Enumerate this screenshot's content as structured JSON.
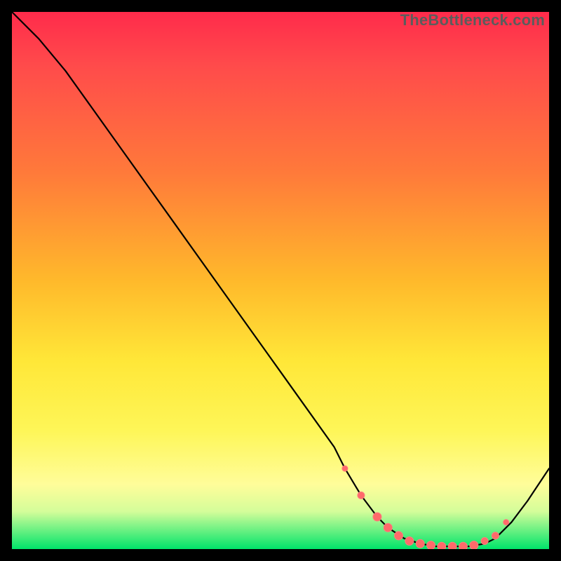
{
  "watermark": "TheBottleneck.com",
  "colors": {
    "curve": "#000000",
    "dot": "#ff6a6a",
    "gradient_top": "#ff2b4b",
    "gradient_bottom": "#00e46a"
  },
  "chart_data": {
    "type": "line",
    "title": "",
    "xlabel": "",
    "ylabel": "",
    "xlim": [
      0,
      100
    ],
    "ylim": [
      0,
      100
    ],
    "series": [
      {
        "name": "curve",
        "x": [
          0,
          5,
          10,
          15,
          20,
          25,
          30,
          35,
          40,
          45,
          50,
          55,
          60,
          62,
          65,
          68,
          70,
          73,
          76,
          79,
          82,
          85,
          88,
          90,
          93,
          96,
          100
        ],
        "y": [
          100,
          95,
          89,
          82,
          75,
          68,
          61,
          54,
          47,
          40,
          33,
          26,
          19,
          15,
          10,
          6,
          4,
          2,
          1,
          0.5,
          0.5,
          0.5,
          1,
          2,
          5,
          9,
          15
        ]
      }
    ],
    "markers": {
      "name": "dots",
      "x": [
        62,
        65,
        68,
        70,
        72,
        74,
        76,
        78,
        80,
        82,
        84,
        86,
        88,
        90,
        92
      ],
      "y": [
        15,
        10,
        6,
        4,
        2.5,
        1.5,
        1,
        0.7,
        0.5,
        0.5,
        0.5,
        0.7,
        1.5,
        2.5,
        5
      ],
      "r": [
        4,
        5,
        6,
        6,
        6,
        6,
        6,
        6,
        6,
        6,
        6,
        6,
        5,
        5,
        4
      ]
    }
  }
}
